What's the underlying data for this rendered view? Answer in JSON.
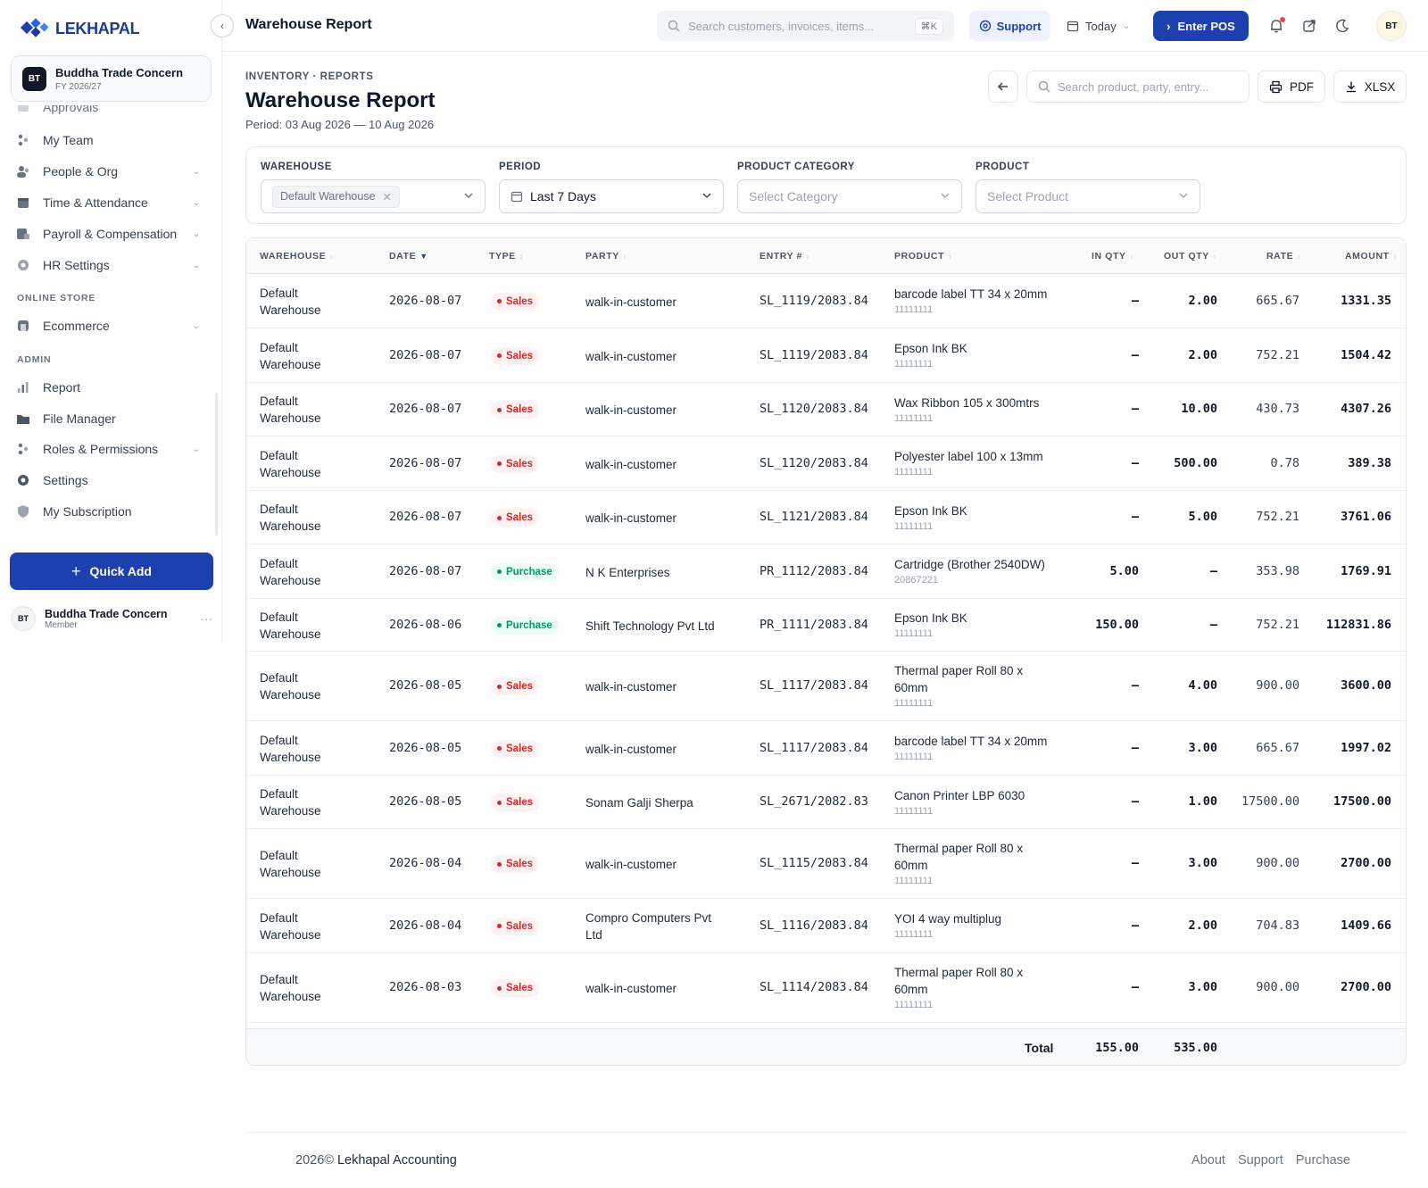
{
  "brand": {
    "name": "LEKHAPAL"
  },
  "org": {
    "badge": "BT",
    "name": "Buddha Trade Concern",
    "fy": "FY 2026/27"
  },
  "sidebar": {
    "partial_item": "Approvals",
    "items": [
      {
        "label": "My Team",
        "icon": "team-icon",
        "chevron": false
      },
      {
        "label": "People & Org",
        "icon": "people-icon",
        "chevron": true
      },
      {
        "label": "Time & Attendance",
        "icon": "calendar-icon",
        "chevron": true
      },
      {
        "label": "Payroll & Compensation",
        "icon": "payroll-icon",
        "chevron": true
      },
      {
        "label": "HR Settings",
        "icon": "gear-icon",
        "chevron": true
      }
    ],
    "section_store": "ONLINE STORE",
    "store_items": [
      {
        "label": "Ecommerce",
        "icon": "store-icon",
        "chevron": true
      }
    ],
    "section_admin": "ADMIN",
    "admin_items": [
      {
        "label": "Report",
        "icon": "bar-chart-icon",
        "chevron": false
      },
      {
        "label": "File Manager",
        "icon": "folder-icon",
        "chevron": false
      },
      {
        "label": "Roles & Permissions",
        "icon": "roles-icon",
        "chevron": true
      },
      {
        "label": "Settings",
        "icon": "settings-icon",
        "chevron": false
      },
      {
        "label": "My Subscription",
        "icon": "shield-icon",
        "chevron": false
      }
    ],
    "quick_add": "Quick Add",
    "user": {
      "initials": "BT",
      "name": "Buddha Trade Concern",
      "role": "Member"
    }
  },
  "header": {
    "title": "Warehouse Report",
    "search_placeholder": "Search customers, invoices, items...",
    "shortcut": "⌘K",
    "support": "Support",
    "today": "Today",
    "enter_pos": "Enter POS",
    "avatar": "BT"
  },
  "page": {
    "breadcrumb": "INVENTORY · REPORTS",
    "title": "Warehouse Report",
    "period": "Period: 03 Aug 2026 — 10 Aug 2026",
    "search_placeholder": "Search product, party, entry...",
    "pdf": "PDF",
    "xlsx": "XLSX"
  },
  "filters": {
    "warehouse_label": "WAREHOUSE",
    "warehouse_value": "Default Warehouse",
    "period_label": "PERIOD",
    "period_value": "Last 7 Days",
    "category_label": "PRODUCT CATEGORY",
    "category_placeholder": "Select Category",
    "product_label": "PRODUCT",
    "product_placeholder": "Select Product"
  },
  "table": {
    "columns": [
      "WAREHOUSE",
      "DATE",
      "TYPE",
      "PARTY",
      "ENTRY #",
      "PRODUCT",
      "IN QTY",
      "OUT QTY",
      "RATE",
      "AMOUNT"
    ],
    "rows": [
      {
        "warehouse": [
          "Default",
          "Warehouse"
        ],
        "date": "2026-08-07",
        "type": "Sales",
        "party": [
          "walk-in-customer"
        ],
        "entry": "SL_1119/2083.84",
        "product": [
          "barcode label TT 34 x 20mm"
        ],
        "code": "11111111",
        "in": "–",
        "out": "2.00",
        "rate": "665.67",
        "amount": "1331.35"
      },
      {
        "warehouse": [
          "Default",
          "Warehouse"
        ],
        "date": "2026-08-07",
        "type": "Sales",
        "party": [
          "walk-in-customer"
        ],
        "entry": "SL_1119/2083.84",
        "product": [
          "Epson Ink BK"
        ],
        "code": "11111111",
        "in": "–",
        "out": "2.00",
        "rate": "752.21",
        "amount": "1504.42"
      },
      {
        "warehouse": [
          "Default",
          "Warehouse"
        ],
        "date": "2026-08-07",
        "type": "Sales",
        "party": [
          "walk-in-customer"
        ],
        "entry": "SL_1120/2083.84",
        "product": [
          "Wax Ribbon 105 x 300mtrs"
        ],
        "code": "11111111",
        "in": "–",
        "out": "10.00",
        "rate": "430.73",
        "amount": "4307.26"
      },
      {
        "warehouse": [
          "Default",
          "Warehouse"
        ],
        "date": "2026-08-07",
        "type": "Sales",
        "party": [
          "walk-in-customer"
        ],
        "entry": "SL_1120/2083.84",
        "product": [
          "Polyester label 100 x 13mm"
        ],
        "code": "11111111",
        "in": "–",
        "out": "500.00",
        "rate": "0.78",
        "amount": "389.38"
      },
      {
        "warehouse": [
          "Default",
          "Warehouse"
        ],
        "date": "2026-08-07",
        "type": "Sales",
        "party": [
          "walk-in-customer"
        ],
        "entry": "SL_1121/2083.84",
        "product": [
          "Epson Ink BK"
        ],
        "code": "11111111",
        "in": "–",
        "out": "5.00",
        "rate": "752.21",
        "amount": "3761.06"
      },
      {
        "warehouse": [
          "Default",
          "Warehouse"
        ],
        "date": "2026-08-07",
        "type": "Purchase",
        "party": [
          "N K Enterprises"
        ],
        "entry": "PR_1112/2083.84",
        "product": [
          "Cartridge (Brother 2540DW)"
        ],
        "code": "20867221",
        "in": "5.00",
        "out": "–",
        "rate": "353.98",
        "amount": "1769.91"
      },
      {
        "warehouse": [
          "Default",
          "Warehouse"
        ],
        "date": "2026-08-06",
        "type": "Purchase",
        "party": [
          "Shift Technology Pvt Ltd"
        ],
        "entry": "PR_1111/2083.84",
        "product": [
          "Epson Ink BK"
        ],
        "code": "11111111",
        "in": "150.00",
        "out": "–",
        "rate": "752.21",
        "amount": "112831.86"
      },
      {
        "warehouse": [
          "Default",
          "Warehouse"
        ],
        "date": "2026-08-05",
        "type": "Sales",
        "party": [
          "walk-in-customer"
        ],
        "entry": "SL_1117/2083.84",
        "product": [
          "Thermal paper Roll 80 x",
          "60mm"
        ],
        "code": "11111111",
        "in": "–",
        "out": "4.00",
        "rate": "900.00",
        "amount": "3600.00"
      },
      {
        "warehouse": [
          "Default",
          "Warehouse"
        ],
        "date": "2026-08-05",
        "type": "Sales",
        "party": [
          "walk-in-customer"
        ],
        "entry": "SL_1117/2083.84",
        "product": [
          "barcode label TT 34 x 20mm"
        ],
        "code": "11111111",
        "in": "–",
        "out": "3.00",
        "rate": "665.67",
        "amount": "1997.02"
      },
      {
        "warehouse": [
          "Default",
          "Warehouse"
        ],
        "date": "2026-08-05",
        "type": "Sales",
        "party": [
          "Sonam Galji Sherpa"
        ],
        "entry": "SL_2671/2082.83",
        "product": [
          "Canon Printer LBP 6030"
        ],
        "code": "11111111",
        "in": "–",
        "out": "1.00",
        "rate": "17500.00",
        "amount": "17500.00"
      },
      {
        "warehouse": [
          "Default",
          "Warehouse"
        ],
        "date": "2026-08-04",
        "type": "Sales",
        "party": [
          "walk-in-customer"
        ],
        "entry": "SL_1115/2083.84",
        "product": [
          "Thermal paper Roll 80 x",
          "60mm"
        ],
        "code": "11111111",
        "in": "–",
        "out": "3.00",
        "rate": "900.00",
        "amount": "2700.00"
      },
      {
        "warehouse": [
          "Default",
          "Warehouse"
        ],
        "date": "2026-08-04",
        "type": "Sales",
        "party": [
          "Compro Computers Pvt",
          "Ltd"
        ],
        "entry": "SL_1116/2083.84",
        "product": [
          "YOI 4 way multiplug"
        ],
        "code": "11111111",
        "in": "–",
        "out": "2.00",
        "rate": "704.83",
        "amount": "1409.66"
      },
      {
        "warehouse": [
          "Default",
          "Warehouse"
        ],
        "date": "2026-08-03",
        "type": "Sales",
        "party": [
          "walk-in-customer"
        ],
        "entry": "SL_1114/2083.84",
        "product": [
          "Thermal paper Roll 80 x",
          "60mm"
        ],
        "code": "11111111",
        "in": "–",
        "out": "3.00",
        "rate": "900.00",
        "amount": "2700.00"
      }
    ],
    "total_label": "Total",
    "total_in": "155.00",
    "total_out": "535.00"
  },
  "footer": {
    "year": "2026©",
    "brand": "Lekhapal Accounting",
    "links": [
      "About",
      "Support",
      "Purchase"
    ]
  },
  "colors": {
    "primary": "#1e40af",
    "sales": "#dc2626",
    "purchase": "#059669"
  }
}
